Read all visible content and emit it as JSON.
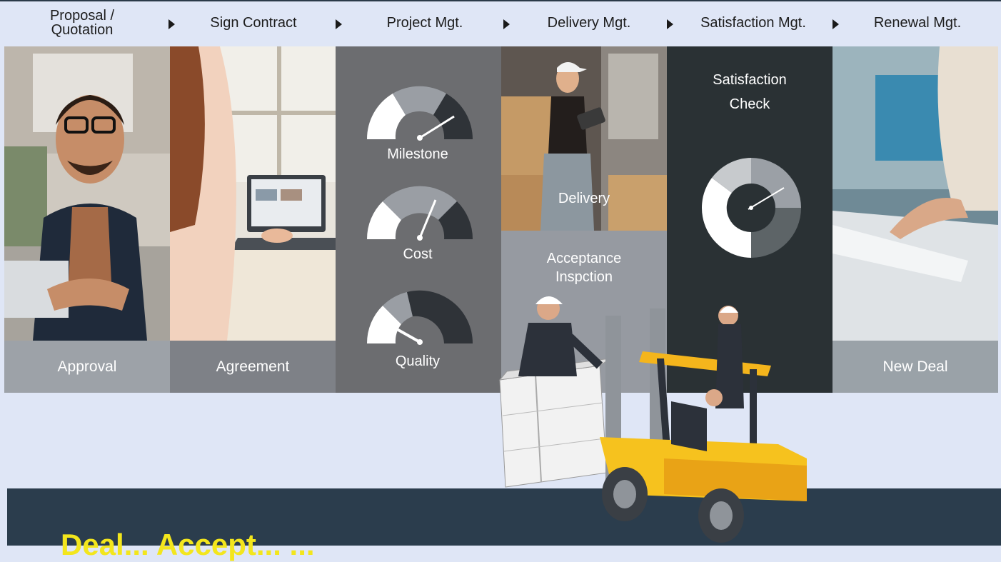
{
  "process_steps": [
    {
      "label": "Proposal /\nQuotation"
    },
    {
      "label": "Sign Contract"
    },
    {
      "label": "Project Mgt."
    },
    {
      "label": "Delivery Mgt."
    },
    {
      "label": "Satisfaction Mgt."
    },
    {
      "label": "Renewal Mgt."
    }
  ],
  "panels": {
    "approval": {
      "caption": "Approval"
    },
    "agreement": {
      "caption": "Agreement"
    },
    "project": {
      "gauges": [
        {
          "label": "Milestone"
        },
        {
          "label": "Cost"
        },
        {
          "label": "Quality"
        }
      ]
    },
    "delivery": {
      "caption": "Delivery",
      "acceptance_label": "Acceptance\nInspction"
    },
    "satisfaction": {
      "title": "Satisfaction\nCheck"
    },
    "renewal": {
      "caption": "New Deal"
    }
  },
  "bottom": {
    "title": "Deal... Accept... ..."
  },
  "colors": {
    "panel_dark": "#2a3134",
    "panel_gray": "#6c6d70",
    "panel_light": "#969aa1",
    "band": "#2b3d4d",
    "accent_yellow": "#f3e61c",
    "forklift_yellow": "#f4b51c"
  }
}
